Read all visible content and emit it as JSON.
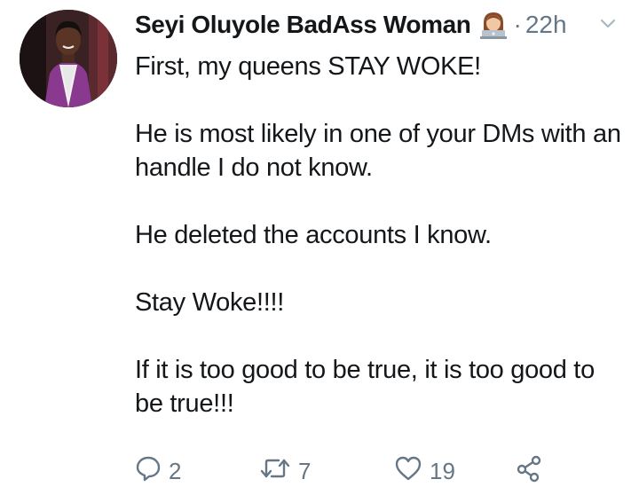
{
  "tweet": {
    "display_name": "Seyi Oluyole BadAss Woman",
    "separator": "·",
    "timestamp": "22h",
    "name_emoji_icon": "woman-technologist-emoji",
    "paragraphs": [
      "First, my queens STAY WOKE!",
      "He is most likely in one of your DMs with an handle I do not know.",
      "He deleted the accounts I know.",
      "Stay Woke!!!!",
      "If it is too good to be true, it is too good to be true!!!"
    ],
    "actions": {
      "reply": {
        "icon": "reply-icon",
        "count": "2"
      },
      "retweet": {
        "icon": "retweet-icon",
        "count": "7"
      },
      "like": {
        "icon": "heart-icon",
        "count": "19"
      },
      "share": {
        "icon": "share-icon"
      }
    }
  },
  "colors": {
    "text": "#14171a",
    "muted": "#657786",
    "background": "#ffffff"
  }
}
